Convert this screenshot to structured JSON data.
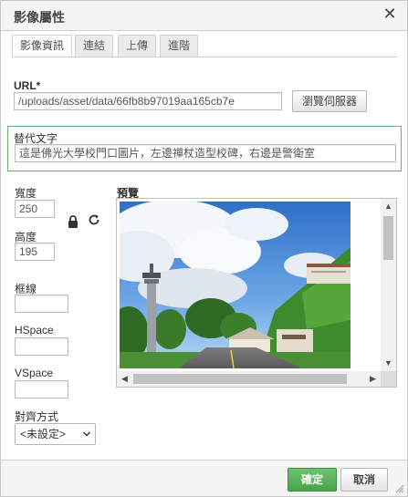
{
  "dialog": {
    "title": "影像屬性",
    "close_symbol": "✕"
  },
  "tabs": [
    {
      "label": "影像資訊",
      "active": true
    },
    {
      "label": "連結",
      "active": false
    },
    {
      "label": "上傳",
      "active": false
    },
    {
      "label": "進階",
      "active": false
    }
  ],
  "url": {
    "label": "URL*",
    "value": "/uploads/asset/data/66fb8b97019aa165cb7e",
    "browse_button": "瀏覽伺服器"
  },
  "alt": {
    "label": "替代文字",
    "value": "這是佛光大學校門口圖片，左邊禪杖造型校碑，右邊是警衛室"
  },
  "size": {
    "width_label": "寬度",
    "width_value": "250",
    "height_label": "高度",
    "height_value": "195",
    "lock_icon": "lock-icon",
    "reset_icon": "reset-size-icon"
  },
  "border": {
    "label": "框線",
    "value": ""
  },
  "hspace": {
    "label": "HSpace",
    "value": ""
  },
  "vspace": {
    "label": "VSpace",
    "value": ""
  },
  "align": {
    "label": "對齊方式",
    "selected": "<未設定>"
  },
  "preview": {
    "label": "預覽"
  },
  "footer": {
    "ok": "確定",
    "cancel": "取消"
  },
  "colors": {
    "ok_green": "#55b055",
    "alt_border": "#6ab06a"
  }
}
